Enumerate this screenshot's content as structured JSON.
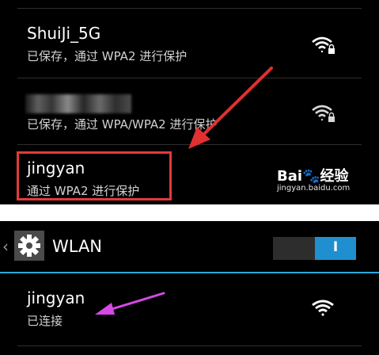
{
  "networks_list": [
    {
      "name": "ShuiJi_5G",
      "status": "已保存，通过 WPA2 进行保护",
      "signal_icon": "wifi-lock-icon"
    },
    {
      "name": "",
      "status": "已保存，通过 WPA/WPA2 进行保护",
      "signal_icon": "wifi-lock-icon",
      "name_obscured": true
    },
    {
      "name": "jingyan",
      "status": "通过 WPA2 进行保护"
    }
  ],
  "watermark": {
    "logo": "Bai🐾经验",
    "url": "jingyan.baidu.com"
  },
  "wlan_screen": {
    "back_icon": "chevron-left-icon",
    "settings_icon": "gear-icon",
    "title": "WLAN",
    "toggle_label": "I",
    "toggle_on": true,
    "accent_color": "#2aa8dd",
    "connected_network": {
      "name": "jingyan",
      "status": "已连接",
      "signal_icon": "wifi-icon"
    }
  },
  "annotations": {
    "highlight_color": "#e43a3a",
    "red_arrow_color": "#e03030",
    "magenta_arrow_color": "#d648e8"
  }
}
